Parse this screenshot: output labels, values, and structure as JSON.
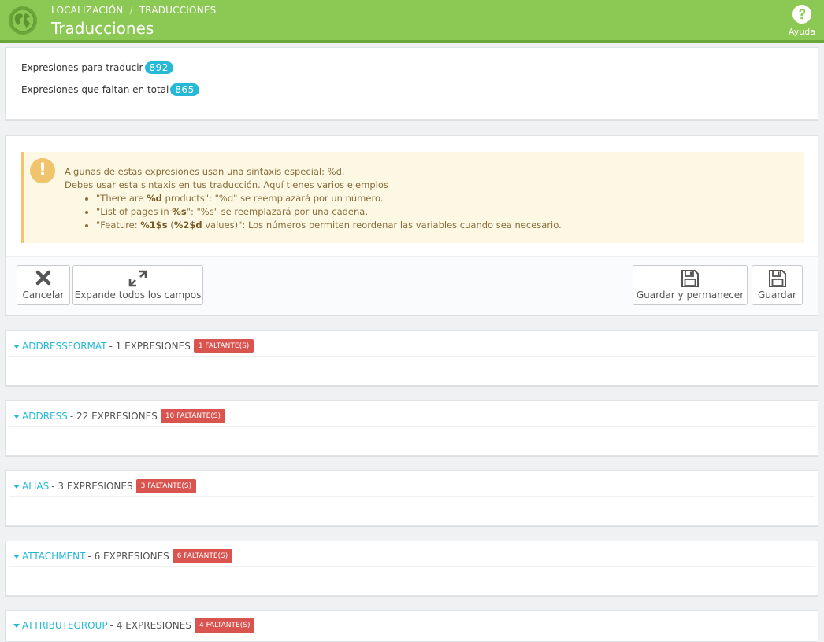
{
  "header": {
    "breadcrumb": [
      "LOCALIZACIÓN",
      "TRADUCCIONES"
    ],
    "breadcrumb_separator": "/",
    "title": "Traducciones",
    "help_label": "Ayuda"
  },
  "stats": {
    "to_translate_label": "Expresiones para traducir",
    "to_translate_count": "892",
    "missing_label": "Expresiones que faltan en total",
    "missing_count": "865"
  },
  "alert": {
    "line1": "Algunas de estas expresiones usan una sintaxis especial: %d.",
    "line2": "Debes usar esta sintaxis en tus traducción. Aquí tienes varios ejemplos",
    "examples": [
      {
        "a": "\"There are ",
        "b": "%d",
        "c": " products\": \"%d\" se reemplazará por un número."
      },
      {
        "a": "\"List of pages in ",
        "b": "%s",
        "c": "\": \"%s\" se reemplazará por una cadena."
      },
      {
        "a": "\"Feature: ",
        "b": "%1$s",
        "c": " (",
        "d": "%2$d",
        "e": " values)\": Los números permiten reordenar las variables cuando sea necesario."
      }
    ]
  },
  "toolbar": {
    "cancel_label": "Cancelar",
    "expand_label": "Expande todos los campos",
    "save_stay_label": "Guardar y permanecer",
    "save_label": "Guardar"
  },
  "sections": [
    {
      "name": "ADDRESSFORMAT",
      "count": "- 1 EXPRESIONES",
      "missing": "1 FALTANTE(S)"
    },
    {
      "name": "ADDRESS",
      "count": "- 22 EXPRESIONES",
      "missing": "10 FALTANTE(S)"
    },
    {
      "name": "ALIAS",
      "count": "- 3 EXPRESIONES",
      "missing": "3 FALTANTE(S)"
    },
    {
      "name": "ATTACHMENT",
      "count": "- 6 EXPRESIONES",
      "missing": "6 FALTANTE(S)"
    },
    {
      "name": "ATTRIBUTEGROUP",
      "count": "- 4 EXPRESIONES",
      "missing": "4 FALTANTE(S)"
    }
  ],
  "colors": {
    "header": "#8bc954",
    "accent": "#25b9d7",
    "danger": "#d9534f",
    "warning_bg": "#fcf8e3"
  },
  "icons": {
    "logo": "globe-icon",
    "help": "question-circle-icon",
    "cancel": "close-icon",
    "expand": "expand-arrows-icon",
    "save": "floppy-disk-icon",
    "warning": "exclamation-icon"
  }
}
